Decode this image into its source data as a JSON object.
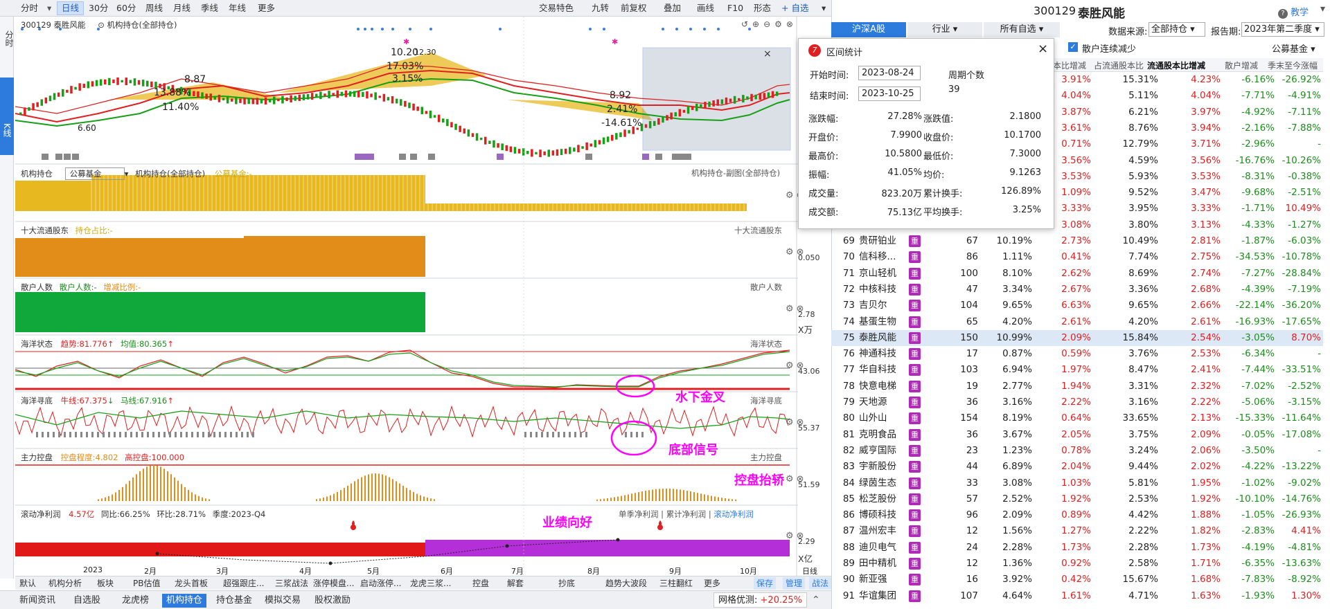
{
  "toolbar": {
    "items": [
      "分时",
      "日线",
      "30分",
      "60分",
      "周线",
      "月线",
      "季线",
      "年线",
      "更多"
    ],
    "right": [
      "交易特色",
      "九转",
      "前复权",
      "叠加",
      "画线",
      "F10",
      "形态",
      "自选"
    ]
  },
  "sidebar": {
    "tabs": [
      "分时",
      "K线"
    ]
  },
  "chart": {
    "stock": "300129 泰胜风能",
    "indicator": "机构持仓(全部持仓)",
    "labels": [
      "8.87",
      "13.88%",
      "11.40%",
      "6.60",
      "10.20",
      "12.30",
      "17.03%",
      "3.15%",
      "8.92",
      "2.41%",
      "-14.61%"
    ],
    "months": [
      "2023",
      "2月",
      "3月",
      "4月",
      "5月",
      "6月",
      "7月",
      "8月",
      "9月",
      "10月",
      "日线"
    ]
  },
  "panels": {
    "p1": {
      "title": "机构持仓",
      "select": "公募基金",
      "sub": "机构持仓(全部持仓)",
      "val": "公募基金:-",
      "right": "机构持仓-副图(全部持仓)"
    },
    "p2": {
      "title": "十大流通股东",
      "val": "持仓占比:-",
      "right": "十大流通股东",
      "axis": "0.050"
    },
    "p3": {
      "title": "散户人数",
      "val1": "散户人数:-",
      "val2": "增减比例:-",
      "right": "散户人数",
      "axis": "2.78",
      "unit": "X万"
    },
    "p4": {
      "title": "海洋状态",
      "val1": "趋势:81.776",
      "val2": "均值:80.365",
      "right": "海洋状态",
      "axis": "43.06"
    },
    "p5": {
      "title": "海洋寻底",
      "val1": "牛线:67.375",
      "val2": "马线:67.916",
      "right": "海洋寻底",
      "axis": "55.37"
    },
    "p6": {
      "title": "主力控盘",
      "val1": "控盘程度:4.802",
      "val2": "高控盘:100.000",
      "right": "主力控盘",
      "axis": "51.59"
    },
    "p7": {
      "title": "滚动净利润",
      "val1": "4.57亿",
      "val2": "同比:66.25%",
      "val3": "环比:28.71%",
      "val4": "季度:2023-Q4",
      "r1": "单季净利润",
      "r2": "累计净利润",
      "r3": "滚动净利润",
      "axis": "2.29",
      "unit": "X亿"
    }
  },
  "annotations": [
    "水下金叉",
    "底部信号",
    "控盘抬轿",
    "业绩向好"
  ],
  "bottom1": [
    "默认",
    "机构分析",
    "板块",
    "PB估值",
    "龙头首板",
    "超强跟庄...",
    "三浆战法",
    "涨停模盘...",
    "启动涨停...",
    "龙虎三浆...",
    "控盘",
    "解套",
    "抄底",
    "趋势大波段",
    "三柱翻红",
    "更多",
    "保存",
    "管理",
    "战法"
  ],
  "bottom2": {
    "tabs": [
      "新闻资讯",
      "自选股",
      "龙虎榜",
      "机构持仓",
      "持仓基金",
      "模拟交易",
      "股权激励"
    ],
    "right": "网格优测:",
    "right_val": "+20.25%"
  },
  "popup": {
    "title": "区间统计",
    "start_l": "开始时间:",
    "start": "2023-08-24",
    "end_l": "结束时间:",
    "end": "2023-10-25",
    "period_l": "周期个数",
    "period": "39",
    "stats": [
      [
        "涨跌幅:",
        "27.28%",
        "涨跌值:",
        "2.1800"
      ],
      [
        "开盘价:",
        "7.9900",
        "收盘价:",
        "10.1700"
      ],
      [
        "最高价:",
        "10.5800",
        "最低价:",
        "7.3000"
      ],
      [
        "振幅:",
        "41.05%",
        "均价:",
        "9.1263"
      ],
      [
        "成交量:",
        "823.20万",
        "累计换手:",
        "126.89%"
      ],
      [
        "成交额:",
        "75.13亿",
        "平均换手:",
        "3.25%"
      ]
    ]
  },
  "right": {
    "code": "300129",
    "name": "泰胜风能",
    "teach": "教学",
    "source_l": "数据来源:",
    "source": "全部持仓",
    "period_l": "报告期:",
    "period": "2023年第二季度",
    "tabs": [
      "沪深A股",
      "行业",
      "所有自选"
    ],
    "check": "散户连续减少",
    "fund": "公募基金",
    "headers": [
      "本比增减",
      "占流通股本比",
      "流通股本比增减",
      "散户增减",
      "季末至今涨幅"
    ],
    "top_rows": [
      [
        "3.91%",
        "15.31%",
        "4.23%",
        "-6.16%",
        "-26.92%"
      ],
      [
        "4.04%",
        "5.11%",
        "4.04%",
        "-7.71%",
        "-4.91%"
      ],
      [
        "3.87%",
        "6.21%",
        "3.97%",
        "-4.92%",
        "-7.11%"
      ],
      [
        "3.61%",
        "8.76%",
        "3.94%",
        "-2.16%",
        "-7.88%"
      ],
      [
        "0.71%",
        "12.79%",
        "3.71%",
        "-2.96%",
        "-"
      ],
      [
        "3.56%",
        "4.59%",
        "3.56%",
        "-16.76%",
        "-10.26%"
      ],
      [
        "3.53%",
        "5.93%",
        "3.53%",
        "-8.31%",
        "-0.38%"
      ],
      [
        "1.09%",
        "9.52%",
        "3.47%",
        "-9.68%",
        "-2.51%"
      ],
      [
        "3.33%",
        "3.95%",
        "3.33%",
        "-1.71%",
        "10.49%"
      ],
      [
        "3.08%",
        "3.80%",
        "3.13%",
        "-4.33%",
        "-1.27%"
      ]
    ],
    "rows": [
      [
        "69",
        "贵研铂业",
        "67",
        "10.19%",
        "2.73%",
        "10.49%",
        "2.81%",
        "-1.87%",
        "-6.03%"
      ],
      [
        "70",
        "信科移...",
        "86",
        "1.11%",
        "0.41%",
        "7.74%",
        "2.75%",
        "-34.53%",
        "-10.78%"
      ],
      [
        "71",
        "京山轻机",
        "100",
        "8.10%",
        "2.62%",
        "8.69%",
        "2.74%",
        "-7.27%",
        "-28.84%"
      ],
      [
        "72",
        "中核科技",
        "47",
        "3.34%",
        "2.67%",
        "3.36%",
        "2.68%",
        "-4.39%",
        "-7.19%"
      ],
      [
        "73",
        "吉贝尔",
        "104",
        "9.65%",
        "6.63%",
        "9.65%",
        "2.66%",
        "-22.14%",
        "-36.20%"
      ],
      [
        "74",
        "基蛋生物",
        "65",
        "4.20%",
        "2.61%",
        "4.20%",
        "2.61%",
        "-16.93%",
        "-17.65%"
      ],
      [
        "75",
        "泰胜风能",
        "150",
        "10.99%",
        "2.09%",
        "15.84%",
        "2.54%",
        "-3.05%",
        "8.70%"
      ],
      [
        "76",
        "神通科技",
        "17",
        "0.87%",
        "0.59%",
        "3.76%",
        "2.53%",
        "-6.34%",
        "-"
      ],
      [
        "77",
        "华自科技",
        "103",
        "6.94%",
        "1.97%",
        "8.47%",
        "2.41%",
        "-7.44%",
        "-33.51%"
      ],
      [
        "78",
        "快意电梯",
        "19",
        "2.77%",
        "1.94%",
        "3.31%",
        "2.32%",
        "-7.02%",
        "-2.52%"
      ],
      [
        "79",
        "天地源",
        "36",
        "3.16%",
        "2.22%",
        "3.16%",
        "2.22%",
        "-5.06%",
        "-3.15%"
      ],
      [
        "80",
        "山外山",
        "154",
        "8.19%",
        "0.64%",
        "33.65%",
        "2.13%",
        "-15.33%",
        "-11.64%"
      ],
      [
        "81",
        "克明食品",
        "36",
        "3.67%",
        "2.05%",
        "3.75%",
        "2.09%",
        "-0.05%",
        "-17.08%"
      ],
      [
        "82",
        "威亨国际",
        "23",
        "1.23%",
        "0.78%",
        "3.24%",
        "2.06%",
        "-3.50%",
        "-"
      ],
      [
        "83",
        "宇新股份",
        "44",
        "6.89%",
        "2.04%",
        "9.44%",
        "2.02%",
        "-4.22%",
        "-13.22%"
      ],
      [
        "84",
        "绿茵生态",
        "33",
        "3.08%",
        "1.03%",
        "5.81%",
        "1.95%",
        "-1.02%",
        "-9.02%"
      ],
      [
        "85",
        "松芝股份",
        "57",
        "2.52%",
        "1.92%",
        "2.53%",
        "1.92%",
        "-10.10%",
        "-14.76%"
      ],
      [
        "86",
        "博硕科技",
        "96",
        "2.09%",
        "0.89%",
        "4.42%",
        "1.88%",
        "-1.05%",
        "-26.93%"
      ],
      [
        "87",
        "温州宏丰",
        "12",
        "1.56%",
        "1.27%",
        "2.22%",
        "1.82%",
        "-2.83%",
        "4.41%"
      ],
      [
        "88",
        "迪贝电气",
        "24",
        "2.28%",
        "1.73%",
        "2.28%",
        "1.73%",
        "-4.19%",
        "-4.81%"
      ],
      [
        "89",
        "田中精机",
        "12",
        "1.36%",
        "0.92%",
        "2.58%",
        "1.71%",
        "-6.35%",
        "-13.63%"
      ],
      [
        "90",
        "新亚强",
        "16",
        "3.92%",
        "0.42%",
        "15.67%",
        "1.68%",
        "-7.83%",
        "-8.92%"
      ],
      [
        "91",
        "华谊集团",
        "107",
        "4.64%",
        "1.61%",
        "4.71%",
        "1.63%",
        "-1.93%",
        "1.30%"
      ]
    ],
    "tag": "重"
  }
}
